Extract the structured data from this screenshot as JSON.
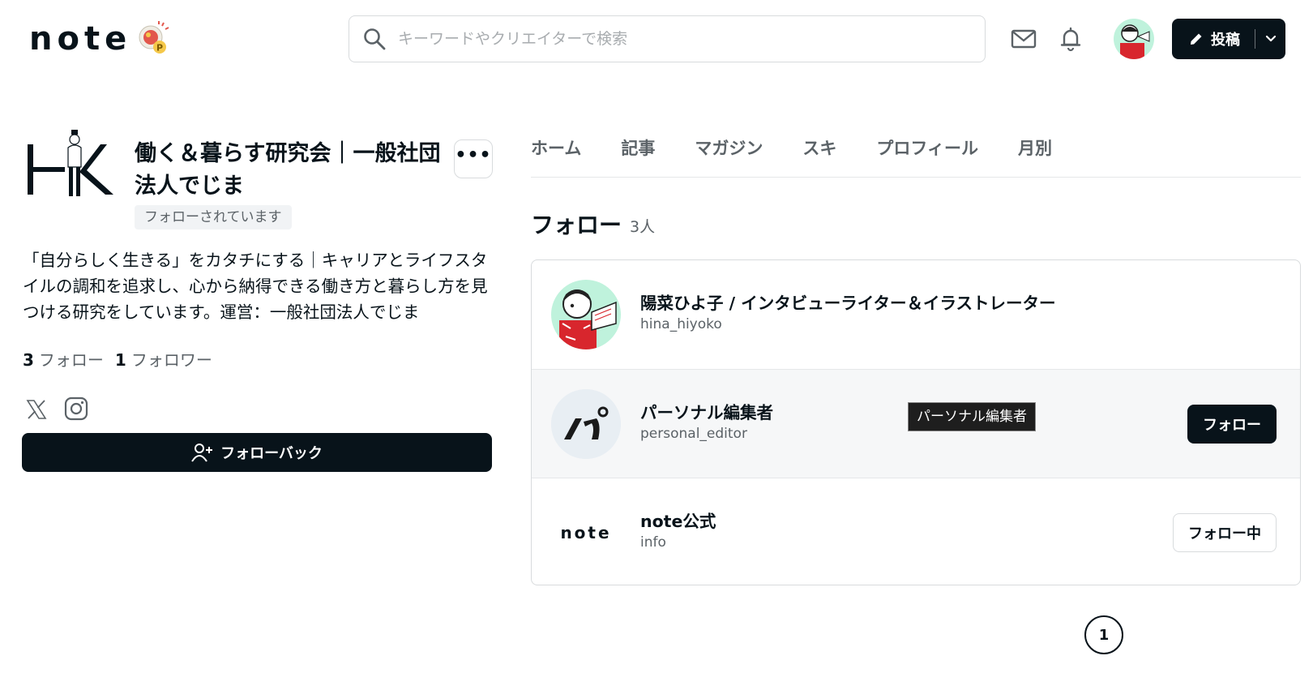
{
  "header": {
    "logo_text": "note",
    "search_placeholder": "キーワードやクリエイターで検索",
    "post_label": "投稿",
    "icons": [
      "search-icon",
      "mail-icon",
      "bell-icon",
      "pencil-icon",
      "chevron-down-icon"
    ]
  },
  "profile": {
    "name": "働く＆暮らす研究会｜一般社団法人でじま",
    "followed_badge": "フォローされています",
    "bio": "「自分らしく生きる」をカタチにする｜キャリアとライフスタイルの調和を追求し、心から納得できる働き方と暮らし方を見つける研究をしています。運営：一般社団法人でじま",
    "follow_count": "3",
    "follow_label": "フォロー",
    "follower_count": "1",
    "follower_label": "フォロワー",
    "follow_back_label": "フォローバック",
    "more_label": "•••"
  },
  "tabs": [
    {
      "label": "ホーム"
    },
    {
      "label": "記事"
    },
    {
      "label": "マガジン"
    },
    {
      "label": "スキ"
    },
    {
      "label": "プロフィール"
    },
    {
      "label": "月別"
    }
  ],
  "section": {
    "title": "フォロー",
    "count": "3人"
  },
  "follows": [
    {
      "name": "陽菜ひよ子 / インタビューライター＆イラストレーター",
      "id": "hina_hiyoko",
      "button": ""
    },
    {
      "name": "パーソナル編集者",
      "id": "personal_editor",
      "button": "フォロー",
      "tooltip": "パーソナル編集者"
    },
    {
      "name": "note公式",
      "id": "info",
      "button": "フォロー中",
      "avatar_text": "note"
    }
  ],
  "pagination": {
    "current": "1"
  },
  "colors": {
    "primary": "#08131a",
    "muted": "#5b6267",
    "border": "#d8dbdd",
    "hover_bg": "#f6f7f8"
  }
}
